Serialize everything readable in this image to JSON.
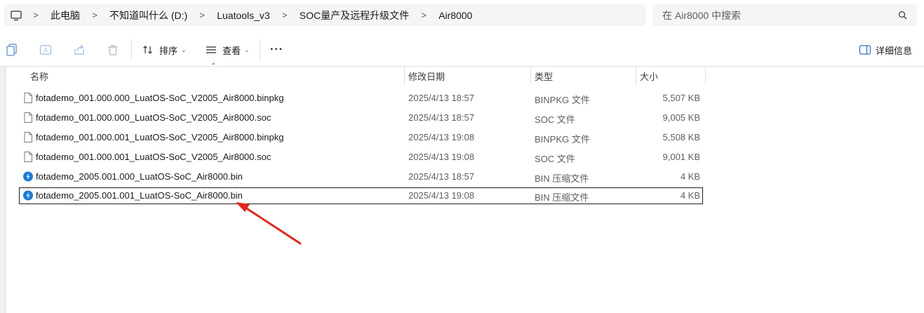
{
  "address_bar": {
    "breadcrumbs": [
      "此电脑",
      "不知道叫什么 (D:)",
      "Luatools_v3",
      "SOC量产及远程升级文件",
      "Air8000"
    ]
  },
  "search": {
    "placeholder": "在 Air8000 中搜索"
  },
  "toolbar": {
    "sort_label": "排序",
    "view_label": "查看",
    "more_label": "···",
    "details_label": "详细信息"
  },
  "columns": {
    "name": "名称",
    "date": "修改日期",
    "type": "类型",
    "size": "大小"
  },
  "files": [
    {
      "name": "fotademo_001.000.000_LuatOS-SoC_V2005_Air8000.binpkg",
      "date": "2025/4/13 18:57",
      "type": "BINPKG 文件",
      "size": "5,507 KB",
      "icon": "generic-file-icon"
    },
    {
      "name": "fotademo_001.000.000_LuatOS-SoC_V2005_Air8000.soc",
      "date": "2025/4/13 18:57",
      "type": "SOC 文件",
      "size": "9,005 KB",
      "icon": "generic-file-icon"
    },
    {
      "name": "fotademo_001.000.001_LuatOS-SoC_V2005_Air8000.binpkg",
      "date": "2025/4/13 19:08",
      "type": "BINPKG 文件",
      "size": "5,508 KB",
      "icon": "generic-file-icon"
    },
    {
      "name": "fotademo_001.000.001_LuatOS-SoC_V2005_Air8000.soc",
      "date": "2025/4/13 19:08",
      "type": "SOC 文件",
      "size": "9,001 KB",
      "icon": "generic-file-icon"
    },
    {
      "name": "fotademo_2005.001.000_LuatOS-SoC_Air8000.bin",
      "date": "2025/4/13 18:57",
      "type": "BIN 压缩文件",
      "size": "4 KB",
      "icon": "bin-archive-icon"
    },
    {
      "name": "fotademo_2005.001.001_LuatOS-SoC_Air8000.bin",
      "date": "2025/4/13 19:08",
      "type": "BIN 压缩文件",
      "size": "4 KB",
      "icon": "bin-archive-icon",
      "selected": true
    }
  ],
  "colors": {
    "accent_blue": "#1c7cd6",
    "annotation_arrow": "#e0281e"
  }
}
